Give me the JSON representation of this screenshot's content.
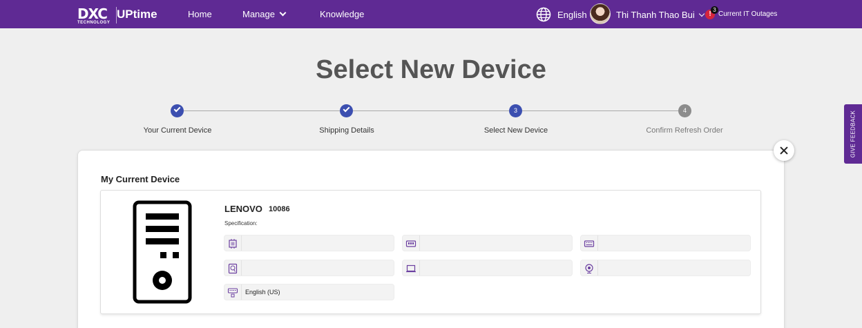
{
  "header": {
    "logo_mark": "DXC",
    "logo_subtext": "TECHNOLOGY",
    "logo_product": "UPtime",
    "nav": [
      {
        "label": "Home"
      },
      {
        "label": "Manage"
      },
      {
        "label": "Knowledge"
      }
    ],
    "language": "English",
    "user_name": "Thi Thanh Thao Bui",
    "alert_symbol": "!",
    "alert_count": "3",
    "outages_label": "Current IT Outages"
  },
  "page": {
    "title": "Select New Device"
  },
  "stepper": {
    "steps": [
      {
        "label": "Your Current Device",
        "state": "done"
      },
      {
        "label": "Shipping Details",
        "state": "done"
      },
      {
        "label": "Select New Device",
        "state": "current",
        "number": "3"
      },
      {
        "label": "Confirm Refresh Order",
        "state": "pending",
        "number": "4"
      }
    ]
  },
  "current_device": {
    "section_title": "My Current Device",
    "brand": "LENOVO",
    "model": "10086",
    "spec_label": "Specification:",
    "specs": [
      {
        "icon": "processor-icon",
        "value": ""
      },
      {
        "icon": "memory-icon",
        "value": ""
      },
      {
        "icon": "keyboard-icon",
        "value": ""
      },
      {
        "icon": "storage-icon",
        "value": ""
      },
      {
        "icon": "screen-icon",
        "value": ""
      },
      {
        "icon": "webcam-icon",
        "value": ""
      },
      {
        "icon": "keyboard-language-icon",
        "value": "English (US)"
      }
    ]
  },
  "feedback": {
    "label": "GIVE FEEDBACK"
  },
  "colors": {
    "brand_purple": "#5f2a94",
    "step_active": "#3c4fb0",
    "step_inactive": "#8c8c8c",
    "alert_red": "#d6253c"
  }
}
